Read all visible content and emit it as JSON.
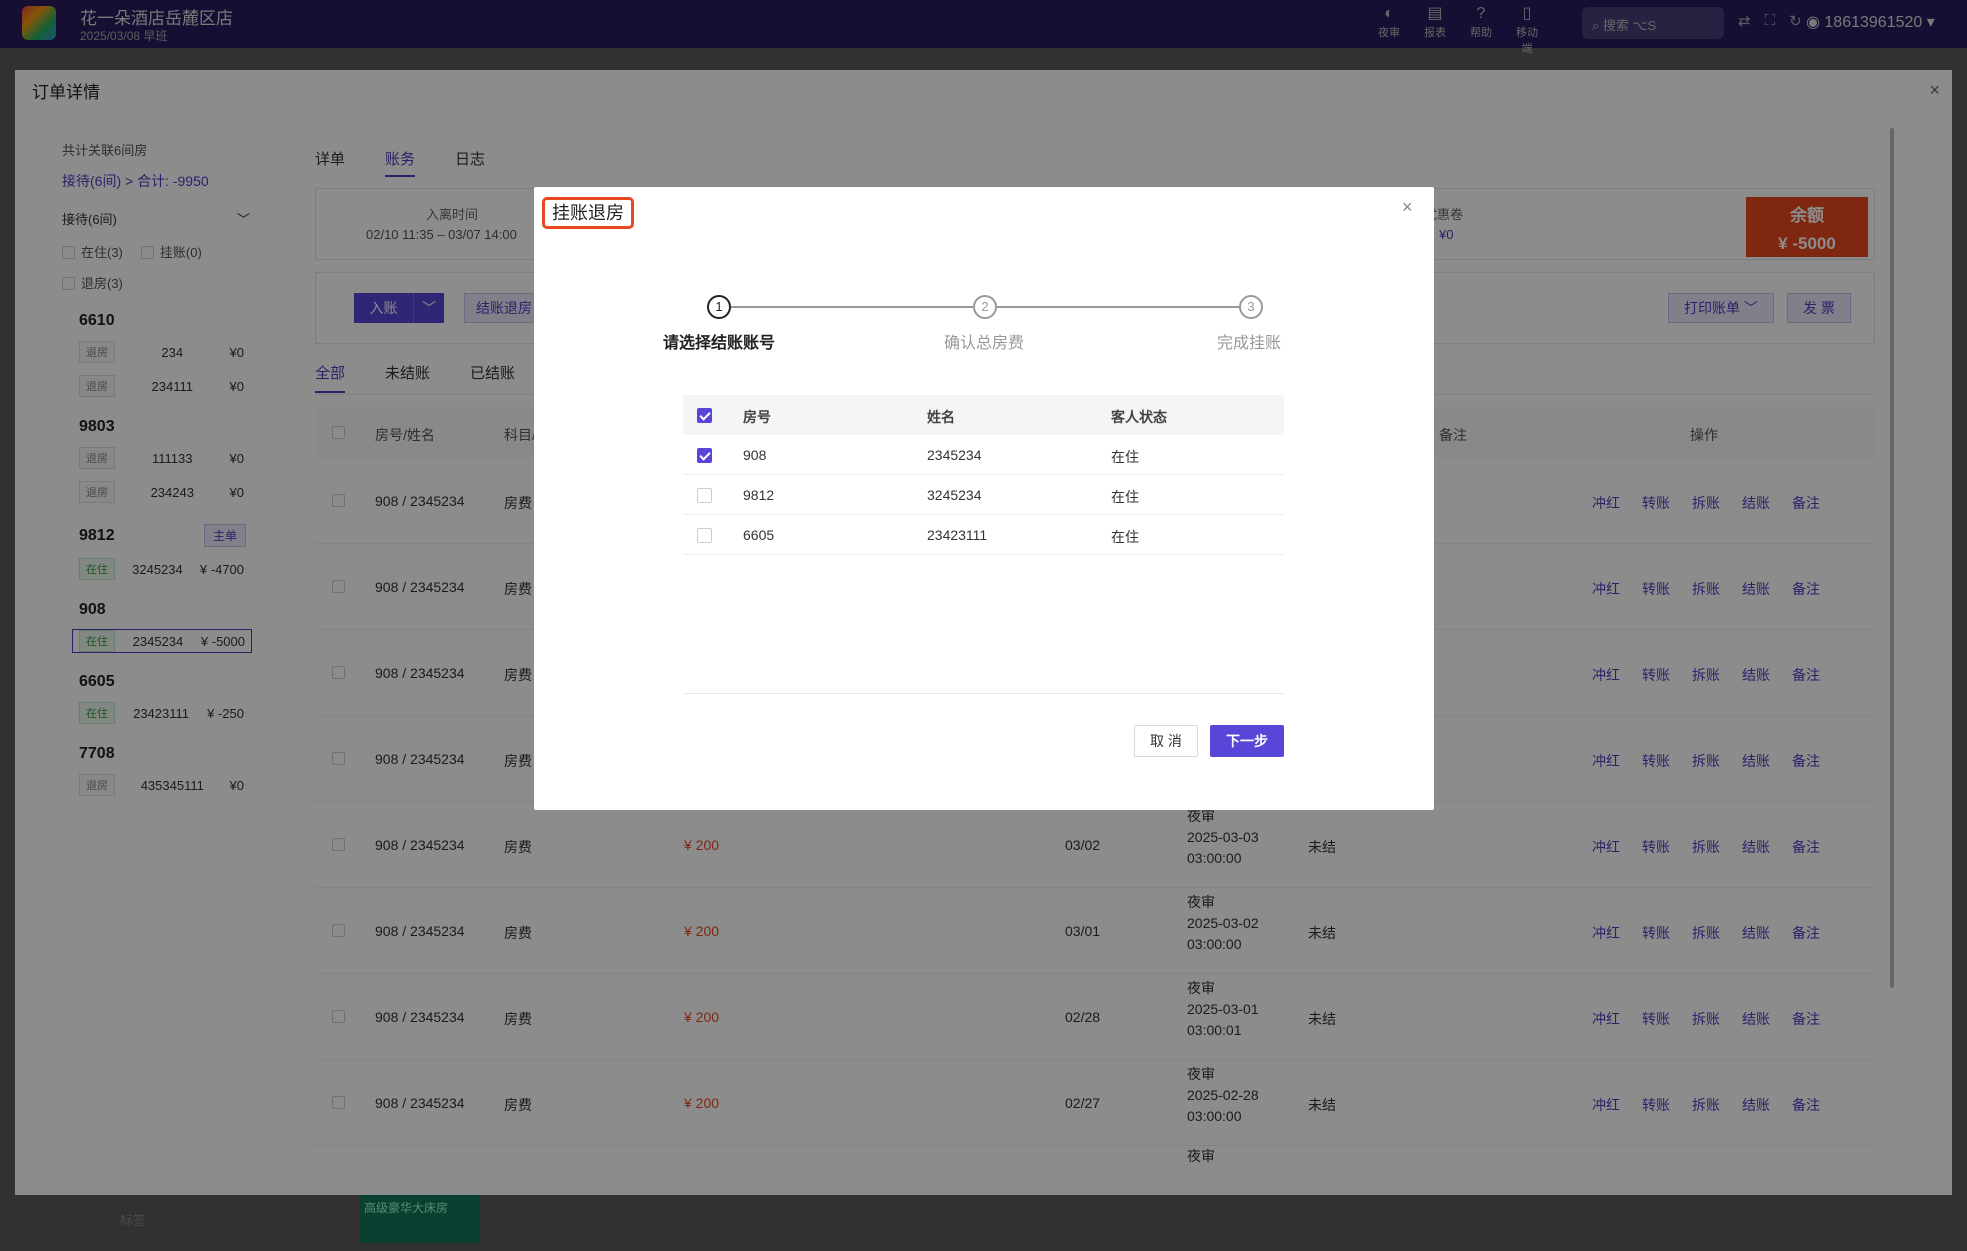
{
  "topbar": {
    "hotel": "花一朵酒店岳麓区店",
    "date": "2025/03/08  早班",
    "tools": [
      {
        "icon": "◐",
        "label": "夜审"
      },
      {
        "icon": "▤",
        "label": "报表"
      },
      {
        "icon": "?",
        "label": "帮助"
      },
      {
        "icon": "▯",
        "label": "移动端"
      }
    ],
    "search_label": "搜索",
    "search_shortcut": "⌥S",
    "user": "18613961520"
  },
  "background": {
    "tag_label": "标签",
    "room_card": "高级豪华大床房"
  },
  "drawer": {
    "title": "订单详情",
    "close": "×",
    "left": {
      "summary": "共计关联6间房",
      "total": "接待(6间) > 合计: -9950",
      "group": "接待(6间)",
      "filter_in": "在住(3)",
      "filter_hang": "挂账(0)",
      "filter_out": "退房(3)",
      "main_badge": "主单",
      "rooms": [
        {
          "no": "6610",
          "rows": [
            {
              "status": "退房",
              "name": "234",
              "amount": "¥0"
            },
            {
              "status": "退房",
              "name": "234111",
              "amount": "¥0"
            }
          ]
        },
        {
          "no": "9803",
          "rows": [
            {
              "status": "退房",
              "name": "111133",
              "amount": "¥0"
            },
            {
              "status": "退房",
              "name": "234243",
              "amount": "¥0"
            }
          ]
        },
        {
          "no": "9812",
          "rows": [
            {
              "status": "在住",
              "name": "3245234",
              "amount": "¥ -4700"
            }
          ]
        },
        {
          "no": "908",
          "rows": [
            {
              "status": "在住",
              "name": "2345234",
              "amount": "¥ -5000"
            }
          ]
        },
        {
          "no": "6605",
          "rows": [
            {
              "status": "在住",
              "name": "23423111",
              "amount": "¥ -250"
            }
          ]
        },
        {
          "no": "7708",
          "rows": [
            {
              "status": "退房",
              "name": "435345111",
              "amount": "¥0"
            }
          ]
        }
      ]
    },
    "right": {
      "tabs": [
        "详单",
        "账务",
        "日志"
      ],
      "info_label": "入离时间",
      "info_value": "02/10 11:35 – 03/07 14:00",
      "coupon_label": "优惠卷",
      "coupon_value": "¥0",
      "balance_label": "余额",
      "balance_value": "¥ -5000",
      "btn_in": "入账",
      "btn_out": "结账退房",
      "btn_print": "打印账单",
      "btn_invoice": "发 票",
      "filter_tabs": [
        "全部",
        "未结账",
        "已结账"
      ],
      "headers": {
        "room": "房号/姓名",
        "item": "科目/",
        "note": "备注",
        "ops": "操作"
      },
      "rows": [
        {
          "room": "908 / 2345234",
          "item": "房费",
          "amount": "",
          "date": "",
          "n1": "",
          "n2": "",
          "n3": "",
          "status": ""
        },
        {
          "room": "908 / 2345234",
          "item": "房费",
          "amount": "",
          "date": "",
          "n1": "",
          "n2": "",
          "n3": "",
          "status": ""
        },
        {
          "room": "908 / 2345234",
          "item": "房费",
          "amount": "",
          "date": "",
          "n1": "",
          "n2": "",
          "n3": "",
          "status": ""
        },
        {
          "room": "908 / 2345234",
          "item": "房费",
          "amount": "",
          "date": "",
          "n1": "",
          "n2": "",
          "n3": "",
          "status": ""
        },
        {
          "room": "908 / 2345234",
          "item": "房费",
          "amount": "¥ 200",
          "date": "03/02",
          "n1": "夜审",
          "n2": "2025-03-03",
          "n3": "03:00:00",
          "status": "未结"
        },
        {
          "room": "908 / 2345234",
          "item": "房费",
          "amount": "¥ 200",
          "date": "03/01",
          "n1": "夜审",
          "n2": "2025-03-02",
          "n3": "03:00:00",
          "status": "未结"
        },
        {
          "room": "908 / 2345234",
          "item": "房费",
          "amount": "¥ 200",
          "date": "02/28",
          "n1": "夜审",
          "n2": "2025-03-01",
          "n3": "03:00:01",
          "status": "未结"
        },
        {
          "room": "908 / 2345234",
          "item": "房费",
          "amount": "¥ 200",
          "date": "02/27",
          "n1": "夜审",
          "n2": "2025-02-28",
          "n3": "03:00:00",
          "status": "未结"
        }
      ],
      "last_note": "夜审",
      "ops": [
        "冲红",
        "转账",
        "拆账",
        "结账",
        "备注"
      ]
    }
  },
  "modal": {
    "title": "挂账退房",
    "close": "×",
    "steps": [
      {
        "num": "1",
        "label": "请选择结账账号",
        "active": true
      },
      {
        "num": "2",
        "label": "确认总房费",
        "active": false
      },
      {
        "num": "3",
        "label": "完成挂账",
        "active": false
      }
    ],
    "columns": [
      "房号",
      "姓名",
      "客人状态"
    ],
    "rows": [
      {
        "room": "908",
        "name": "2345234",
        "status": "在住",
        "checked": true
      },
      {
        "room": "9812",
        "name": "3245234",
        "status": "在住",
        "checked": false
      },
      {
        "room": "6605",
        "name": "23423111",
        "status": "在住",
        "checked": false
      }
    ],
    "cancel": "取 消",
    "next": "下一步"
  },
  "colors": {
    "accent": "#5846d8",
    "danger": "#e8471f",
    "topbar": "#2a1a5e"
  }
}
